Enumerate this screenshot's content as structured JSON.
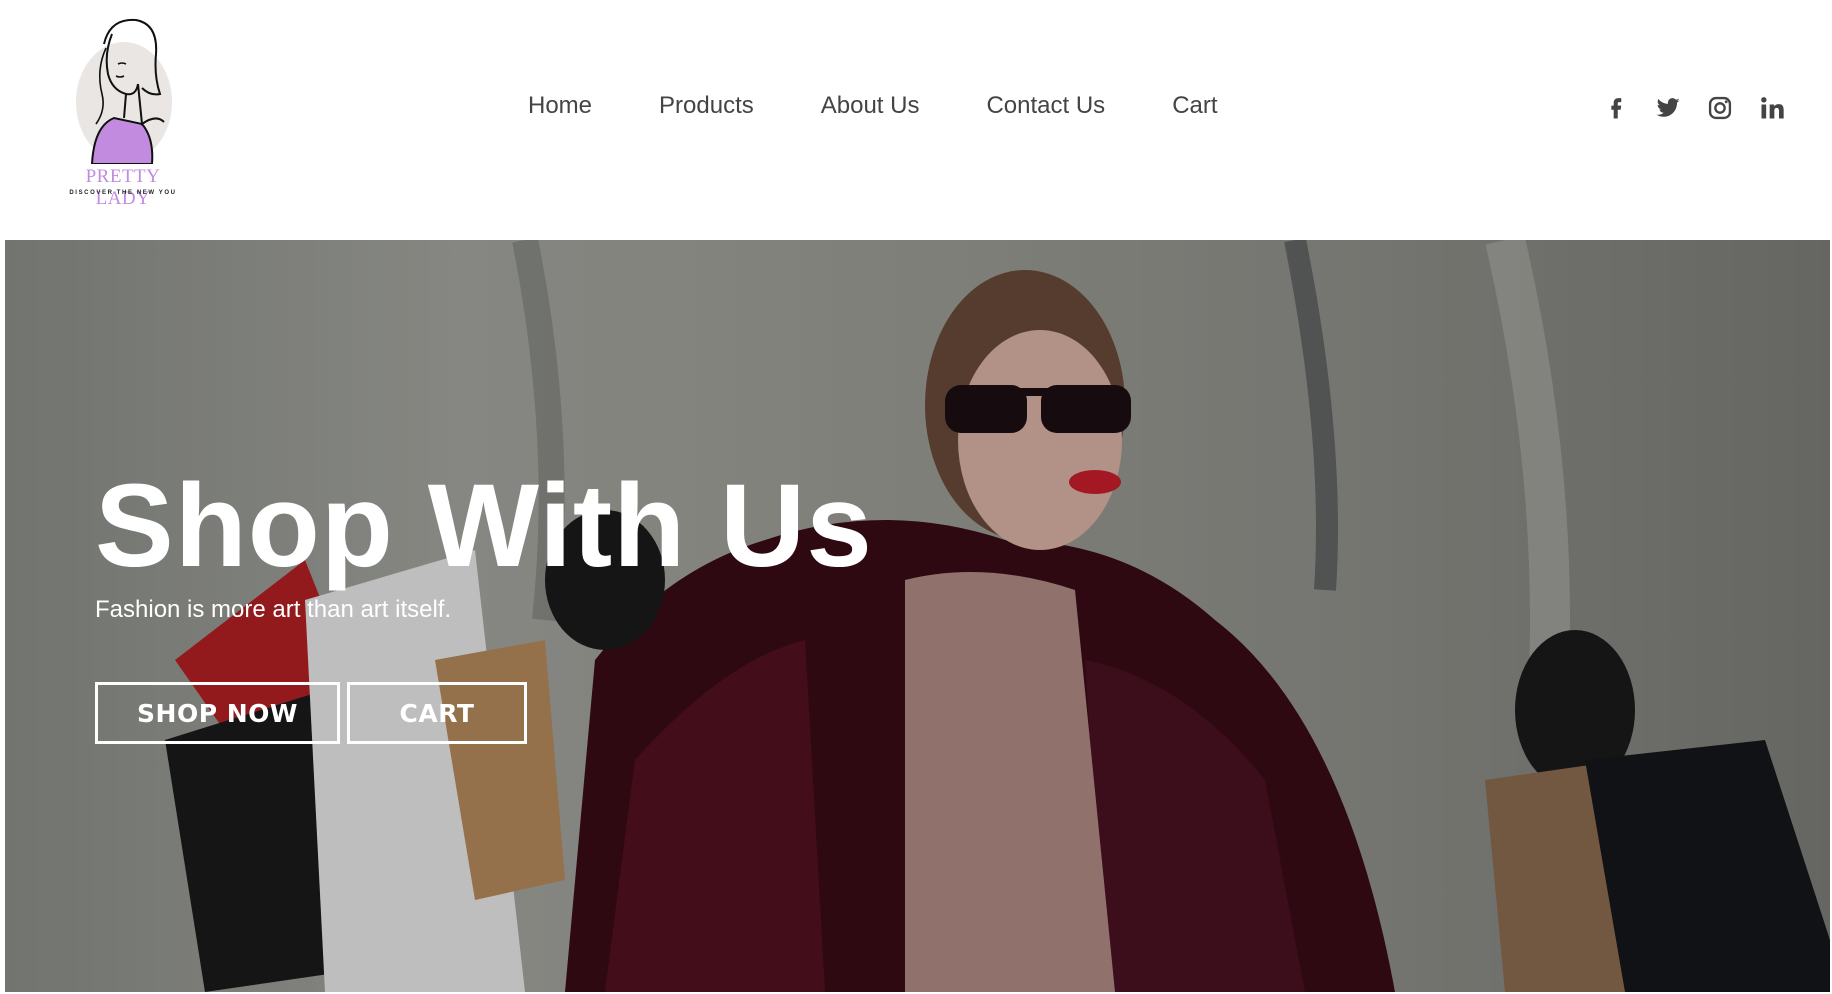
{
  "brand": {
    "name": "PRETTY LADY",
    "tagline": "DISCOVER THE NEW YOU",
    "accent_color": "#c28be0"
  },
  "nav": {
    "items": [
      {
        "label": "Home"
      },
      {
        "label": "Products"
      },
      {
        "label": "About Us"
      },
      {
        "label": "Contact Us"
      },
      {
        "label": "Cart"
      }
    ]
  },
  "social": {
    "icons": [
      "facebook-icon",
      "twitter-icon",
      "instagram-icon",
      "linkedin-icon"
    ]
  },
  "hero": {
    "title": "Shop With Us",
    "subtitle": "Fashion is more art than art itself.",
    "buttons": {
      "shop_now": "SHOP NOW",
      "cart": "CART"
    }
  }
}
